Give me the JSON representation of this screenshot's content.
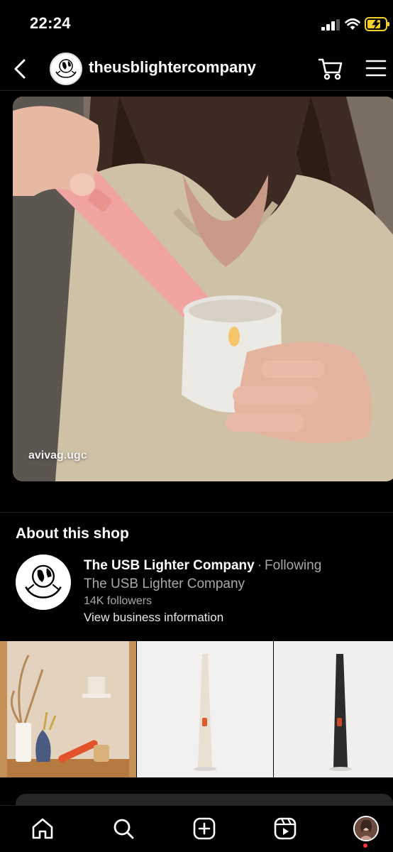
{
  "status_bar": {
    "time": "22:24"
  },
  "header": {
    "shop_handle": "theusblightercompany"
  },
  "photo": {
    "credit": "avivag.ugc"
  },
  "about": {
    "title": "About this shop",
    "shop_name": "The USB Lighter Company",
    "separator": "·",
    "following": "Following",
    "subtitle": "The USB Lighter Company",
    "followers": "14K followers",
    "view_info": "View business information"
  },
  "colors": {
    "background": "#000000",
    "secondary_text": "#a8a8a8",
    "notification_dot": "#ff3040"
  },
  "icons": [
    "back-icon",
    "cart-icon",
    "menu-icon",
    "home-icon",
    "search-icon",
    "create-icon",
    "reels-icon"
  ]
}
